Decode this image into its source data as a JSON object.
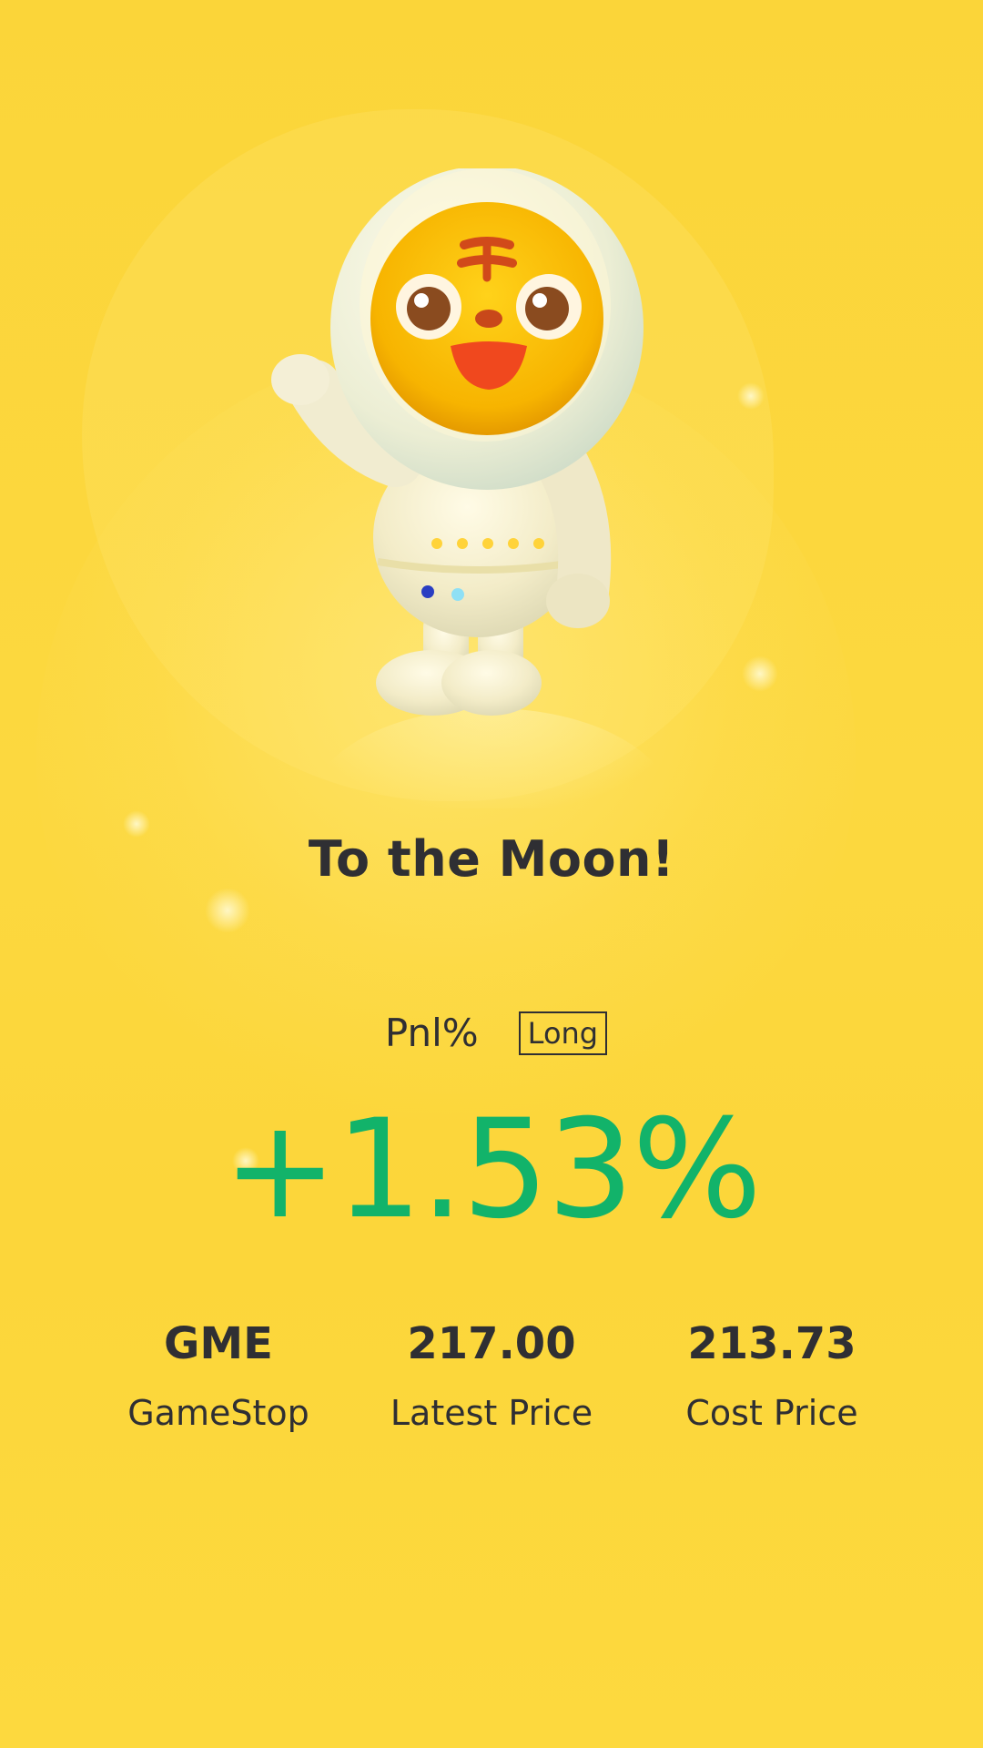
{
  "title": "To the Moon!",
  "pnl": {
    "label": "Pnl%",
    "side": "Long",
    "value": "+1.53%"
  },
  "stats": [
    {
      "value": "GME",
      "label": "GameStop"
    },
    {
      "value": "217.00",
      "label": "Latest Price"
    },
    {
      "value": "213.73",
      "label": "Cost Price"
    }
  ],
  "colors": {
    "background": "#fcd63a",
    "text": "#2f2f33",
    "gain": "#12b36a"
  },
  "illustration": "tiger-astronaut-mascot"
}
